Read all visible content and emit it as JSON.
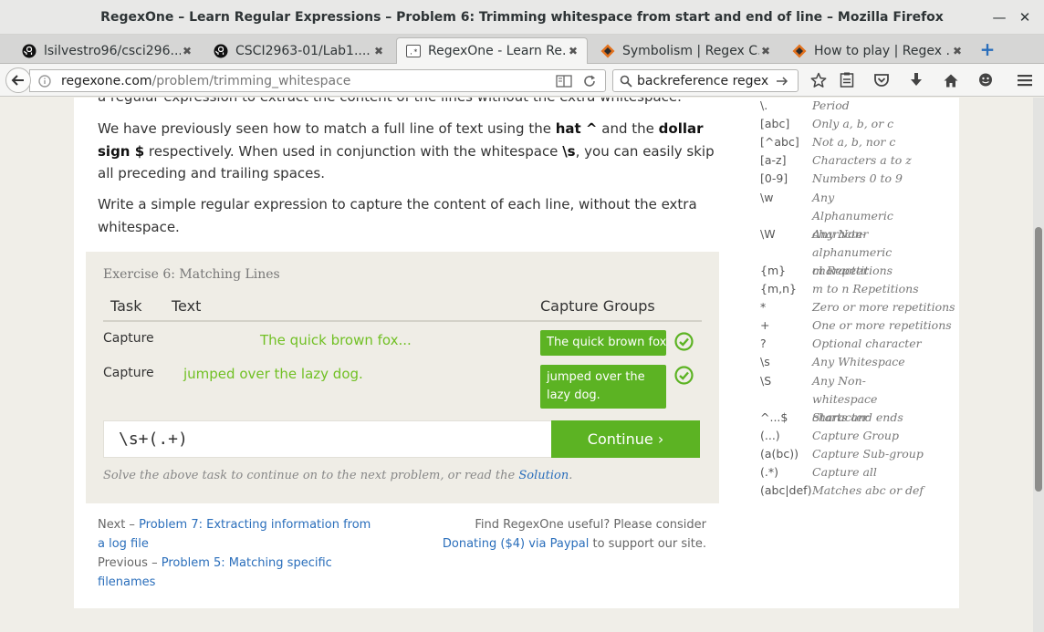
{
  "window": {
    "title": "RegexOne – Learn Regular Expressions – Problem 6: Trimming whitespace from start and end of line – Mozilla Firefox"
  },
  "tabs": [
    {
      "label": "lsilvestro96/csci296...",
      "icon": "github-icon"
    },
    {
      "label": "CSCI2963-01/Lab1....",
      "icon": "github-icon"
    },
    {
      "label": "RegexOne - Learn Re...",
      "icon": "regexone-icon"
    },
    {
      "label": "Symbolism | Regex C...",
      "icon": "regex-crossword-icon"
    },
    {
      "label": "How to play | Regex ...",
      "icon": "regex-crossword-icon"
    }
  ],
  "nav": {
    "url_host": "regexone.com",
    "url_path": "/problem/trimming_whitespace",
    "search_value": "backreference regex"
  },
  "content": {
    "partial_top": "a regular expression to extract the content of the lines without the extra whitespace.",
    "para1_a": "We have previously seen how to match a full line of text using the ",
    "para1_hat": "hat ^",
    "para1_b": " and the ",
    "para1_dollar": "dollar sign $",
    "para1_c": " respectively. When used in conjunction with the whitespace ",
    "para1_s": "\\s",
    "para1_d": ", you can easily skip all preceding and trailing spaces.",
    "para2": "Write a simple regular expression to capture the content of each line, without the extra whitespace."
  },
  "exercise": {
    "title": "Exercise 6: Matching Lines",
    "headers": {
      "task": "Task",
      "text": "Text",
      "capture_groups": "Capture Groups"
    },
    "rows": [
      {
        "task": "Capture",
        "text": "The quick brown fox...",
        "group": "The quick brown fox..."
      },
      {
        "task": "Capture",
        "text": "jumped over the lazy dog.",
        "group": "jumped over the lazy dog."
      }
    ],
    "input_value": "\\s+(.+)",
    "continue_label": "Continue ›",
    "hint_prefix": "Solve the above task to continue on to the next problem, or read the ",
    "hint_link": "Solution",
    "hint_suffix": "."
  },
  "footer": {
    "next_prefix": "Next – ",
    "next_link": "Problem 7: Extracting information from a log file",
    "prev_prefix": "Previous – ",
    "prev_link": "Problem 5: Matching specific filenames",
    "donate_prefix": "Find RegexOne useful? Please consider",
    "donate_link": "Donating ($4) via Paypal",
    "donate_suffix": " to support our site."
  },
  "legend": [
    {
      "key": "\\.",
      "val": "Period"
    },
    {
      "key": "[abc]",
      "val": "Only a, b, or c"
    },
    {
      "key": "[^abc]",
      "val": "Not a, b, nor c"
    },
    {
      "key": "[a-z]",
      "val": "Characters a to z"
    },
    {
      "key": "[0-9]",
      "val": "Numbers 0 to 9"
    },
    {
      "key": "\\w",
      "val": "Any Alphanumeric character"
    },
    {
      "key": "\\W",
      "val": "Any Non-alphanumeric character"
    },
    {
      "key": "{m}",
      "val": "m Repetitions"
    },
    {
      "key": "{m,n}",
      "val": "m to n Repetitions"
    },
    {
      "key": "*",
      "val": "Zero or more repetitions"
    },
    {
      "key": "+",
      "val": "One or more repetitions"
    },
    {
      "key": "?",
      "val": "Optional character"
    },
    {
      "key": "\\s",
      "val": "Any Whitespace"
    },
    {
      "key": "\\S",
      "val": "Any Non-whitespace character"
    },
    {
      "key": "^...$",
      "val": "Starts and ends"
    },
    {
      "key": "(...)",
      "val": "Capture Group"
    },
    {
      "key": "(a(bc))",
      "val": "Capture Sub-group"
    },
    {
      "key": "(.*)",
      "val": "Capture all"
    },
    {
      "key": "(abc|def)",
      "val": "Matches abc or def"
    }
  ]
}
